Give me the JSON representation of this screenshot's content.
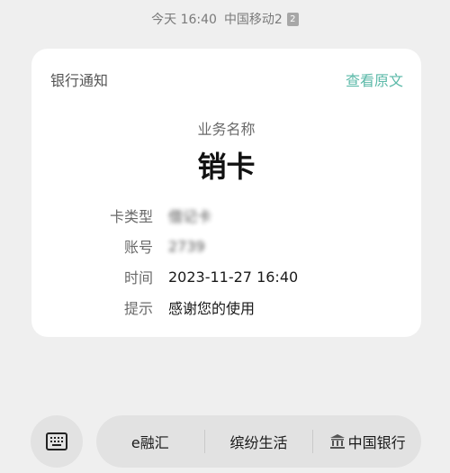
{
  "status": {
    "time": "今天 16:40",
    "carrier": "中国移动2",
    "sim_badge": "2"
  },
  "card": {
    "title": "银行通知",
    "view_original": "查看原文",
    "business_label": "业务名称",
    "business_value": "销卡",
    "rows": [
      {
        "label": "卡类型",
        "value": "借记卡"
      },
      {
        "label": "账号",
        "value": "2739"
      },
      {
        "label": "时间",
        "value": "2023-11-27  16:40"
      },
      {
        "label": "提示",
        "value": "感谢您的使用"
      }
    ]
  },
  "bottom": {
    "keyboard_icon": "keyboard-icon",
    "menu": [
      {
        "label": "e融汇"
      },
      {
        "label": "缤纷生活"
      },
      {
        "label": "中国银行",
        "icon": "bank-icon"
      }
    ]
  },
  "colors": {
    "accent": "#5bb9a8",
    "background": "#efefef",
    "card": "#ffffff"
  }
}
